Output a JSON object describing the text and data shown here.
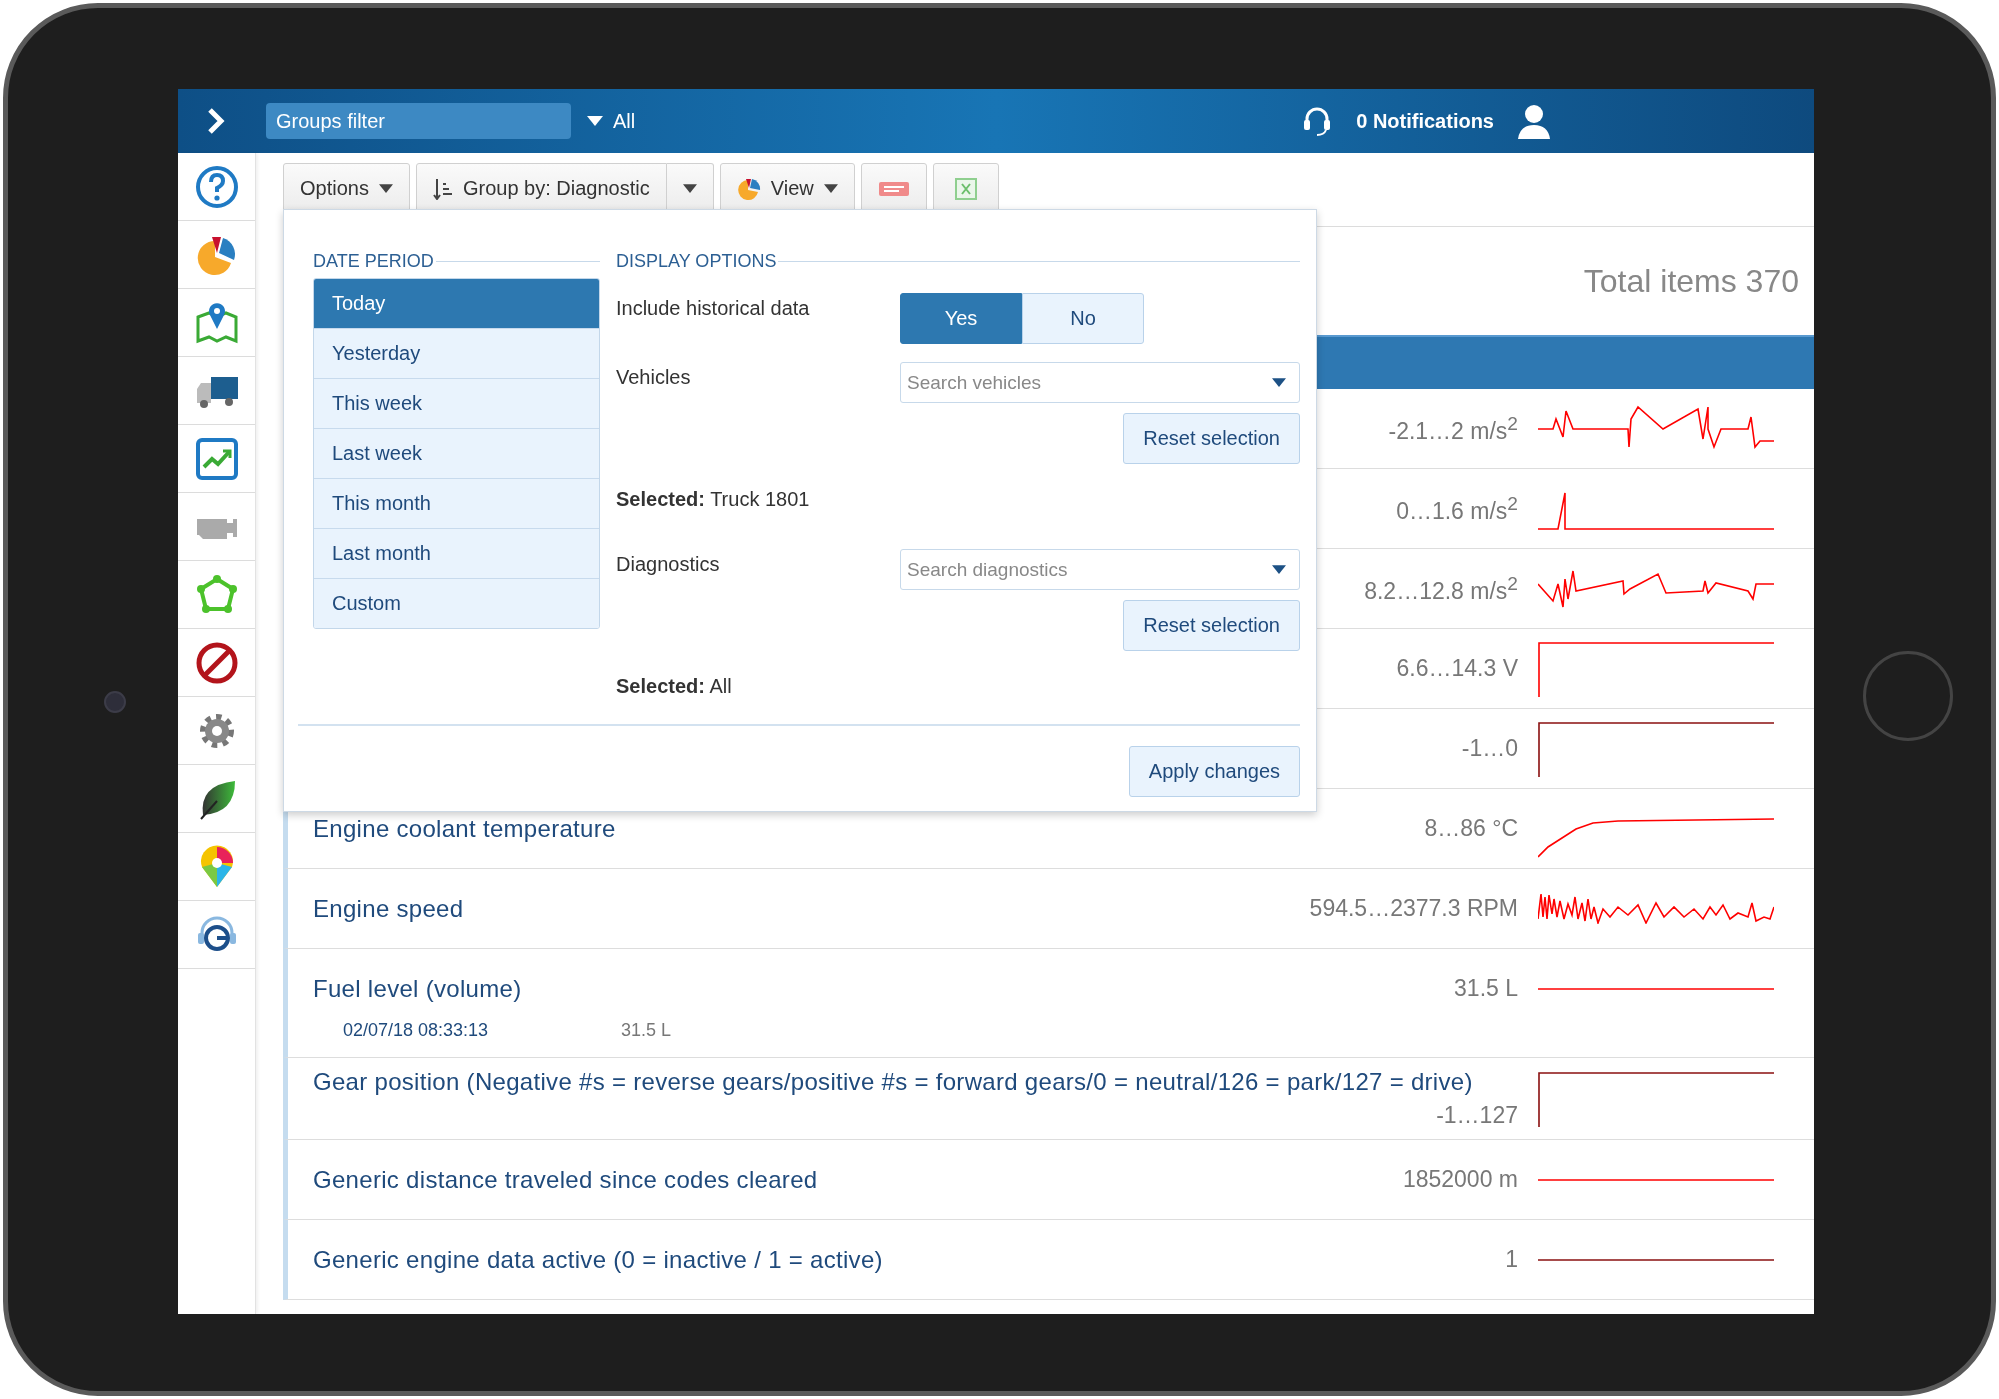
{
  "top_bar": {
    "groups_filter": {
      "placeholder": "Groups filter"
    },
    "group_value": "All",
    "notifications": "0 Notifications"
  },
  "toolbar": {
    "options": "Options",
    "group_by": "Group by: Diagnostic",
    "view": "View"
  },
  "total_items": "Total items 370",
  "rows": [
    {
      "reading": "-2.1…2 m/s$^{2}$"
    },
    {
      "reading": "0…1.6 m/s$^{2}$"
    },
    {
      "reading": "8.2…12.8 m/s$^{2}$"
    },
    {
      "reading": "6.6…14.3 V"
    },
    {
      "reading": "-1…0"
    },
    {
      "name": "Engine coolant temperature",
      "reading": "8…86 °C"
    },
    {
      "name": "Engine speed",
      "reading": "594.5…2377.3 RPM"
    },
    {
      "name": "Fuel level (volume)",
      "reading": "31.5 L",
      "detail": {
        "time": "02/07/18 08:33:13",
        "value": "31.5 L"
      }
    },
    {
      "name": "Gear position (Negative #s = reverse gears/positive #s = forward gears/0 = neutral/126 = park/127 = drive)",
      "reading": "-1…127"
    },
    {
      "name": "Generic distance traveled since codes cleared",
      "reading": "1852000 m"
    },
    {
      "name": "Generic engine data active (0 = inactive / 1 = active)",
      "reading": "1"
    }
  ],
  "options_panel": {
    "date_period": {
      "title": "DATE PERIOD",
      "items": [
        {
          "label": "Today",
          "selected": true
        },
        {
          "label": "Yesterday",
          "selected": false
        },
        {
          "label": "This week",
          "selected": false
        },
        {
          "label": "Last week",
          "selected": false
        },
        {
          "label": "This month",
          "selected": false
        },
        {
          "label": "Last month",
          "selected": false
        },
        {
          "label": "Custom",
          "selected": false
        }
      ]
    },
    "display_options": {
      "title": "DISPLAY OPTIONS",
      "historical": {
        "label": "Include historical data",
        "options": [
          {
            "label": "Yes",
            "selected": true
          },
          {
            "label": "No",
            "selected": false
          }
        ]
      },
      "filters": [
        {
          "label": "Vehicles",
          "placeholder": "Search vehicles",
          "reset": "Reset selection",
          "selection": "**Selected:** Truck 1801"
        },
        {
          "label": "Diagnostics",
          "placeholder": "Search diagnostics",
          "reset": "Reset selection",
          "selection": "**Selected:** All"
        }
      ]
    },
    "apply": "Apply changes"
  }
}
